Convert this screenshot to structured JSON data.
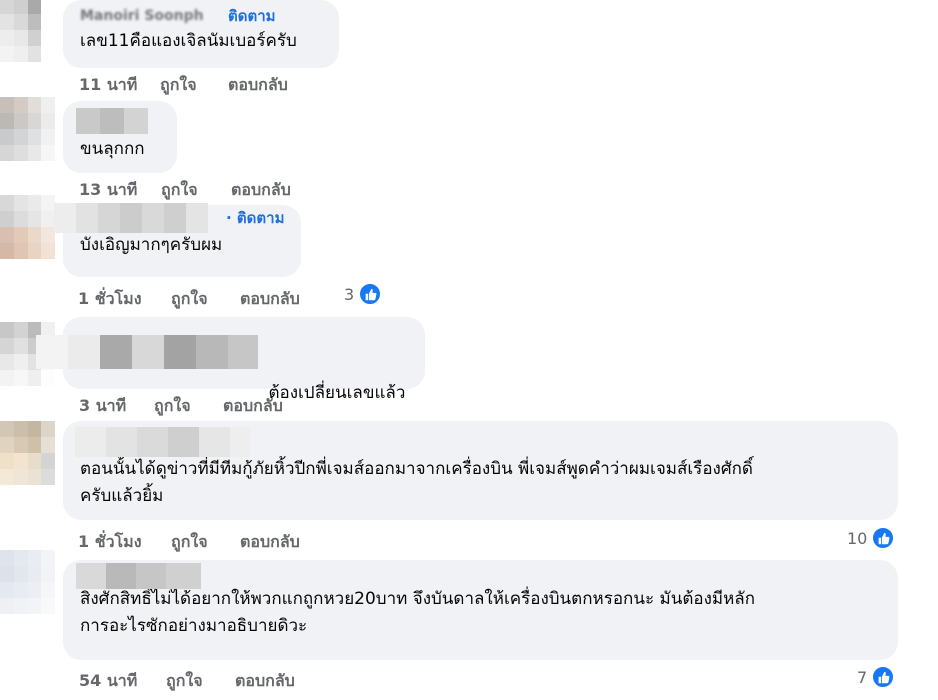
{
  "comments": [
    {
      "author": "Manoiri Soonph",
      "follow": "ติดตาม",
      "text": "เลข11คือแองเจิลนัมเบอร์ครับ",
      "time": "11 นาที",
      "like_label": "ถูกใจ",
      "reply_label": "ตอบกลับ",
      "reactions": ""
    },
    {
      "author": "",
      "follow": "",
      "text": "ขนลุกกก",
      "time": "13 นาที",
      "like_label": "ถูกใจ",
      "reply_label": "ตอบกลับ",
      "reactions": ""
    },
    {
      "author": "",
      "follow": "· ติดตาม",
      "text": "บังเอิญมากๆครับผม",
      "time": "1 ชั่วโมง",
      "like_label": "ถูกใจ",
      "reply_label": "ตอบกลับ",
      "reactions": "3"
    },
    {
      "author": "",
      "follow": "",
      "text": "ต้องเปลี่ยนเลขแล้ว",
      "time": "3 นาที",
      "like_label": "ถูกใจ",
      "reply_label": "ตอบกลับ",
      "reactions": ""
    },
    {
      "author": "",
      "follow": "",
      "text": "ตอนนั้นได้ดูข่าวที่มีทีมกู้ภัยหิ้วปีกพี่เจมส์ออกมาจากเครื่องบิน พี่เจมส์พูดคำว่าผมเจมส์เรืองศักดิ์\nครับแล้วยิ้ม",
      "time": "1 ชั่วโมง",
      "like_label": "ถูกใจ",
      "reply_label": "ตอบกลับ",
      "reactions": "10"
    },
    {
      "author": "",
      "follow": "",
      "text": "สิ่งศักสิทธิ์ไม่ได้อยากให้พวกแกถูกหวย20บาท จึงบันดาลให้เครื่องบินตกหรอกนะ มันต้องมีหลัก\nการอะไรซักอย่างมาอธิบายดิวะ",
      "time": "54 นาที",
      "like_label": "ถูกใจ",
      "reply_label": "ตอบกลับ",
      "reactions": "7"
    }
  ],
  "colors": {
    "bubble": "#f0f2f5",
    "link": "#216fdb",
    "meta": "#65676b",
    "like": "#1877f2"
  },
  "icons": {
    "reaction": "thumbs-up-icon"
  }
}
